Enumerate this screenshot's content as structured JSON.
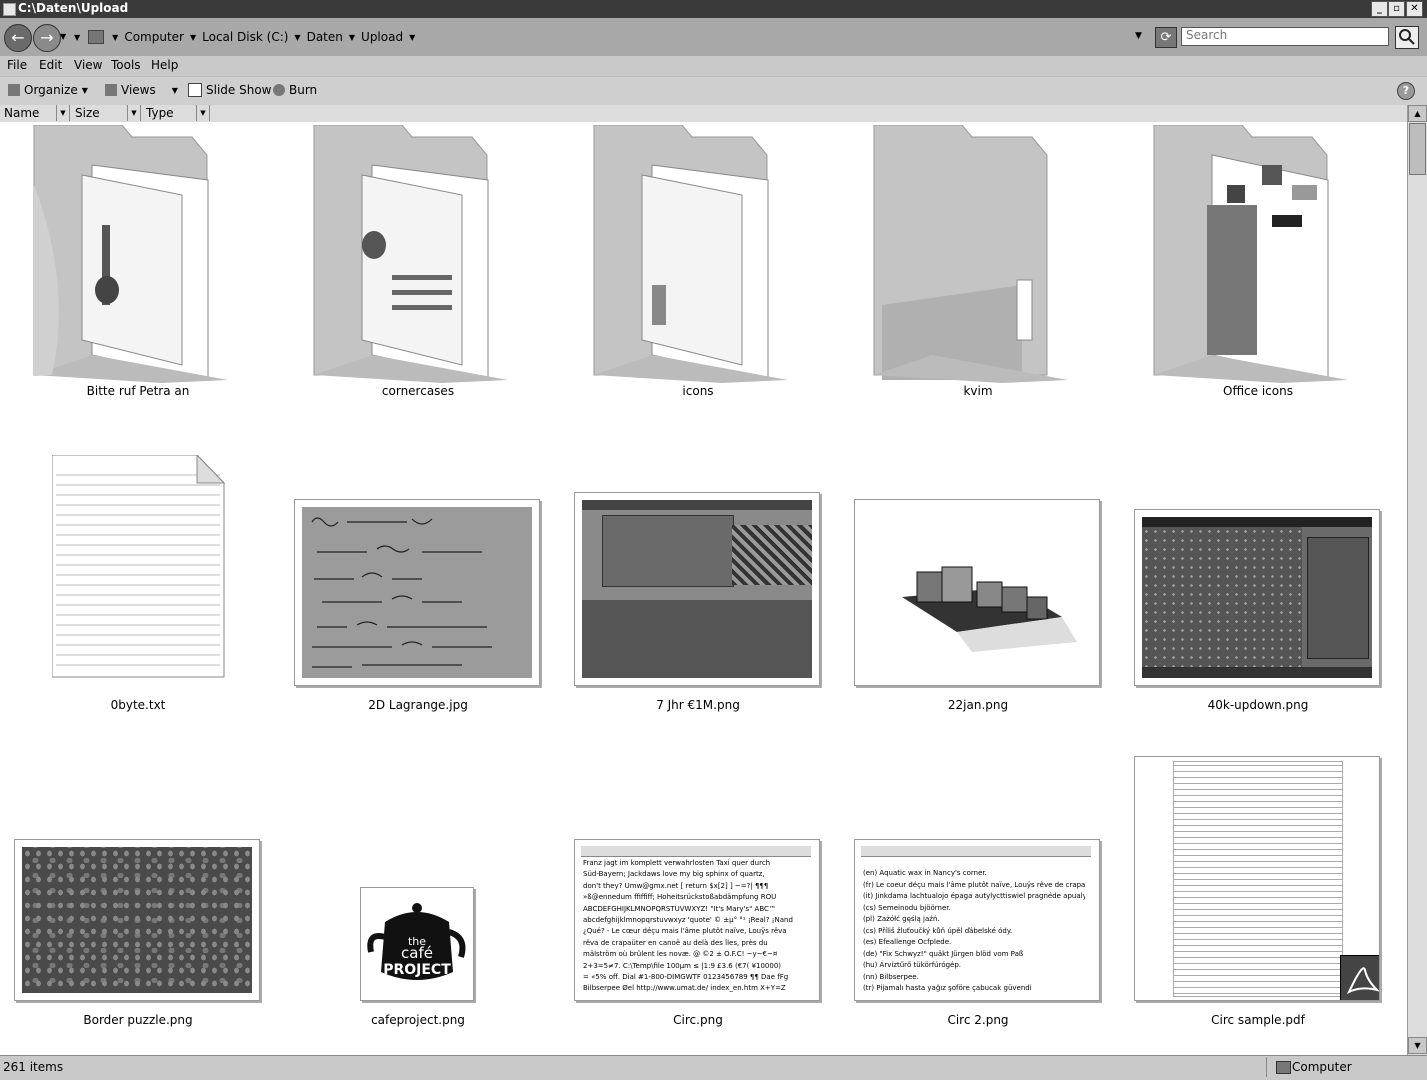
{
  "window": {
    "title": "C:\\Daten\\Upload"
  },
  "address": {
    "crumbs": [
      "Computer",
      "Local Disk (C:)",
      "Daten",
      "Upload"
    ],
    "search_placeholder": "Search"
  },
  "menu": {
    "items": [
      "File",
      "Edit",
      "View",
      "Tools",
      "Help"
    ]
  },
  "toolbar": {
    "organize": "Organize",
    "views": "Views",
    "slideshow": "Slide Show",
    "burn": "Burn"
  },
  "columns": [
    "Name",
    "Size",
    "Type"
  ],
  "files": [
    {
      "name": "Bitte ruf Petra an",
      "kind": "folder-icon"
    },
    {
      "name": "cornercases",
      "kind": "folder-icon"
    },
    {
      "name": "icons",
      "kind": "folder-icon"
    },
    {
      "name": "kvim",
      "kind": "folder-icon"
    },
    {
      "name": "Office icons",
      "kind": "folder-icon"
    },
    {
      "name": "0byte.txt",
      "kind": "text-file-icon"
    },
    {
      "name": "2D Lagrange.jpg",
      "kind": "image-thumbnail"
    },
    {
      "name": "7 Jhr €1M.png",
      "kind": "image-thumbnail"
    },
    {
      "name": "22jan.png",
      "kind": "image-thumbnail"
    },
    {
      "name": "40k-updown.png",
      "kind": "image-thumbnail"
    },
    {
      "name": "Border puzzle.png",
      "kind": "image-thumbnail"
    },
    {
      "name": "cafeproject.png",
      "kind": "image-thumbnail"
    },
    {
      "name": "Circ.png",
      "kind": "image-thumbnail"
    },
    {
      "name": "Circ 2.png",
      "kind": "image-thumbnail"
    },
    {
      "name": "Circ sample.pdf",
      "kind": "pdf-thumbnail"
    }
  ],
  "thumb_text": {
    "cafe_the": "the",
    "cafe_name": "café",
    "cafe_project": "PROJECT",
    "circ_lines": [
      "Franz jagt im komplett verwahrlosten Taxi quer durch",
      "Süd-Bayern; Jackdaws love my big sphinx of quartz,",
      "don't they? Umw@gmx.net [ return $x[2] ] ~=?| ¶¶¶",
      "»ß@ennedum ffiffiff; Hoheitsrückstoßabdämpfung ROU",
      "ABCDEFGHIJKLMNOPQRSTUVWXYZ! \"It's Mary's\" ABC™",
      "abcdefghijklmnopqrstuvwxyz 'quote' © ±µ° °¹ ¡Real? ¡Nand",
      "¿Qué? - Le cœur déçu mais l'âme plutôt naïve, Louÿs rêva",
      "rêva de crapaüter en canoë au delà des îles, près du",
      "mälström où brûlent les novæ. @ ©2 ± O.F.C! ~y~€~¤",
      "2+3=5≠7. C:\\Temp\\file 100µm ≤ |1:9 £3.6 (€7( ¥10000)",
      "= «5% off. Dial #1-800-DIMGWTF 0123456789 ¶¶ Dae fFg",
      "Bilbserpee Øel http://www.umat.de/ index_en.htm X+Y=Z"
    ],
    "circ2_lines": [
      "(en) Aquatic wax in Nancy's corner.",
      "(fr) Le coeur déçu mais l'âme plutôt naïve, Louÿs rêve de crapa",
      "(it) Jinkdama lachtualojo épaga autylycttiswiel pragnéde apualy",
      "(cs) Semeinodu bjöörner.",
      "(pl) Zażółć gęślą jaźń.",
      "(cs) Příliš žluťoučký kůň úpěl ďábelské ódy.",
      "(es) Efeallenge Ocfplede.",
      "(de) \"Fix Schwyz!\" quäkt Jürgen blöd vom Paß",
      "(hu) Árvíztűrő tükörfúrógép.",
      "(nn) Bilbserpee.",
      "(tr) Pijamalı hasta yağız şoföre çabucak güvendi"
    ]
  },
  "status": {
    "count": "261 items",
    "location": "Computer"
  }
}
